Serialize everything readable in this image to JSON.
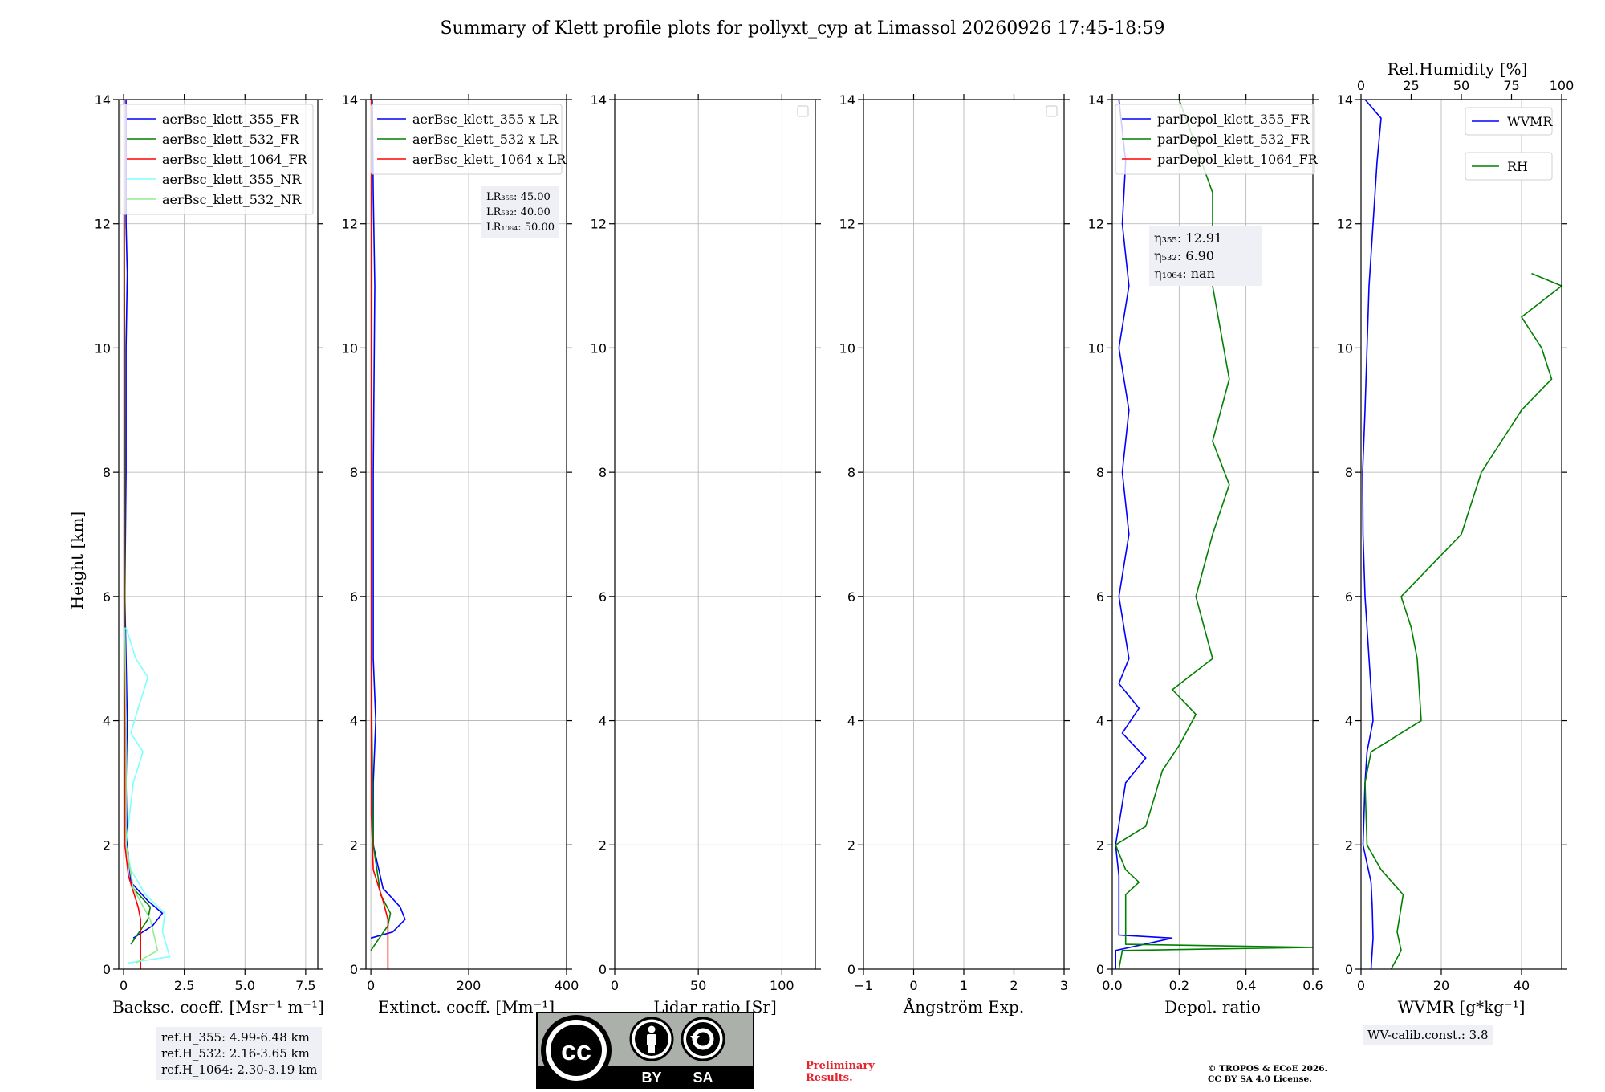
{
  "title": "Summary of Klett profile plots for pollyxt_cyp at Limassol 20260926 17:45-18:59",
  "ylabel": "Height [km]",
  "rh_axis_label": "Rel.Humidity [%]",
  "ref_heights": [
    "ref.H_355: 4.99-6.48 km",
    "ref.H_532: 2.16-3.65 km",
    "ref.H_1064: 2.30-3.19 km"
  ],
  "wv_calib": "WV-calib.const.: 3.8",
  "preliminary": [
    "Preliminary",
    "Results."
  ],
  "copyright": [
    "© TROPOS & ECoE 2026.",
    "CC BY SA 4.0 License."
  ],
  "cc_badge": {
    "text": "cc",
    "by": "BY",
    "sa": "SA"
  },
  "colors": {
    "blue": "#0000ff",
    "green": "#008000",
    "red": "#ff0000",
    "cyan": "#7fffff",
    "lightgreen": "#90ee90"
  },
  "chart_data": [
    {
      "type": "line",
      "id": "backscatter",
      "xlabel": "Backsc. coeff. [Msr⁻¹ m⁻¹]",
      "xlim": [
        -0.2,
        8.0
      ],
      "xticks": [
        "0",
        "2.5",
        "5.0",
        "7.5"
      ],
      "xtick_values": [
        0,
        2.5,
        5.0,
        7.5
      ],
      "ylim": [
        0,
        14
      ],
      "yticks": [
        "0",
        "2",
        "4",
        "6",
        "8",
        "10",
        "12",
        "14"
      ],
      "grid": true,
      "legend_position": "top-right",
      "series": [
        {
          "name": "aerBsc_klett_355_FR",
          "color": "blue",
          "points": [
            [
              0.4,
              0.5
            ],
            [
              1.2,
              0.7
            ],
            [
              1.6,
              0.9
            ],
            [
              1.0,
              1.1
            ],
            [
              0.3,
              1.4
            ],
            [
              0.15,
              2.0
            ],
            [
              0.1,
              3.0
            ],
            [
              0.15,
              4.0
            ],
            [
              0.1,
              5.0
            ],
            [
              0.05,
              6.0
            ],
            [
              0.1,
              8.0
            ],
            [
              0.1,
              10.0
            ],
            [
              0.15,
              11.2
            ],
            [
              0.1,
              12.0
            ],
            [
              0.1,
              14.0
            ]
          ]
        },
        {
          "name": "aerBsc_klett_532_FR",
          "color": "green",
          "points": [
            [
              0.3,
              0.4
            ],
            [
              1.0,
              0.8
            ],
            [
              1.1,
              1.0
            ],
            [
              0.4,
              1.3
            ],
            [
              0.1,
              2.0
            ],
            [
              0.05,
              4.0
            ],
            [
              0.05,
              8.0
            ],
            [
              0.02,
              14.0
            ]
          ]
        },
        {
          "name": "aerBsc_klett_1064_FR",
          "color": "red",
          "points": [
            [
              0.7,
              0.0
            ],
            [
              0.7,
              0.8
            ],
            [
              0.6,
              1.0
            ],
            [
              0.2,
              1.5
            ],
            [
              0.05,
              2.0
            ],
            [
              0.02,
              6.0
            ],
            [
              0.02,
              14.0
            ]
          ]
        },
        {
          "name": "aerBsc_klett_355_NR",
          "color": "cyan",
          "points": [
            [
              0.2,
              0.1
            ],
            [
              1.9,
              0.2
            ],
            [
              1.6,
              0.6
            ],
            [
              1.7,
              0.9
            ],
            [
              0.9,
              1.2
            ],
            [
              0.3,
              1.6
            ],
            [
              0.1,
              2.0
            ],
            [
              0.4,
              3.0
            ],
            [
              0.8,
              3.5
            ],
            [
              0.3,
              3.8
            ],
            [
              0.6,
              4.2
            ],
            [
              1.0,
              4.7
            ],
            [
              0.5,
              5.0
            ],
            [
              0.1,
              5.5
            ]
          ]
        },
        {
          "name": "aerBsc_klett_532_NR",
          "color": "lightgreen",
          "points": [
            [
              0.5,
              0.1
            ],
            [
              1.4,
              0.3
            ],
            [
              1.1,
              0.8
            ],
            [
              0.4,
              1.3
            ],
            [
              0.1,
              2.0
            ],
            [
              0.1,
              4.0
            ],
            [
              0.05,
              5.5
            ]
          ]
        }
      ]
    },
    {
      "type": "line",
      "id": "extinction",
      "xlabel": "Extinct. coeff. [Mm⁻¹]",
      "xlim": [
        -10,
        400
      ],
      "xticks": [
        "0",
        "200",
        "400"
      ],
      "xtick_values": [
        0,
        200,
        400
      ],
      "ylim": [
        0,
        14
      ],
      "yticks": [
        "0",
        "2",
        "4",
        "6",
        "8",
        "10",
        "12",
        "14"
      ],
      "grid": true,
      "legend_position": "top-right",
      "annotation": {
        "lines": [
          "LR₃₅₅: 45.00",
          "LR₅₃₂: 40.00",
          "LR₁₀₆₄: 50.00"
        ]
      },
      "series": [
        {
          "name": "aerBsc_klett_355 x LR",
          "color": "blue",
          "points": [
            [
              0,
              0.5
            ],
            [
              45,
              0.6
            ],
            [
              70,
              0.8
            ],
            [
              60,
              1.0
            ],
            [
              25,
              1.3
            ],
            [
              5,
              2.0
            ],
            [
              5,
              3.0
            ],
            [
              10,
              4.0
            ],
            [
              5,
              5.0
            ],
            [
              5,
              8.0
            ],
            [
              8,
              11.0
            ],
            [
              5,
              12.5
            ],
            [
              3,
              14.0
            ]
          ]
        },
        {
          "name": "aerBsc_klett_532 x LR",
          "color": "green",
          "points": [
            [
              0,
              0.3
            ],
            [
              35,
              0.7
            ],
            [
              40,
              0.9
            ],
            [
              20,
              1.2
            ],
            [
              5,
              2.0
            ],
            [
              2,
              4.0
            ],
            [
              2,
              14.0
            ]
          ]
        },
        {
          "name": "aerBsc_klett_1064 x LR",
          "color": "red",
          "points": [
            [
              35,
              0.0
            ],
            [
              35,
              0.8
            ],
            [
              25,
              1.1
            ],
            [
              5,
              1.6
            ],
            [
              1,
              2.5
            ],
            [
              1,
              14.0
            ]
          ]
        }
      ]
    },
    {
      "type": "line",
      "id": "lidar_ratio",
      "xlabel": "Lidar ratio [Sr]",
      "xlim": [
        0,
        120
      ],
      "xticks": [
        "0",
        "50",
        "100"
      ],
      "xtick_values": [
        0,
        50,
        100
      ],
      "ylim": [
        0,
        14
      ],
      "yticks": [
        "0",
        "2",
        "4",
        "6",
        "8",
        "10",
        "12",
        "14"
      ],
      "grid": true,
      "legend_position": "top-right",
      "series": []
    },
    {
      "type": "line",
      "id": "angstrom",
      "xlabel": "Ångström Exp.",
      "xlim": [
        -1,
        3
      ],
      "xticks": [
        "−1",
        "0",
        "1",
        "2",
        "3"
      ],
      "xtick_values": [
        -1,
        0,
        1,
        2,
        3
      ],
      "ylim": [
        0,
        14
      ],
      "yticks": [
        "0",
        "2",
        "4",
        "6",
        "8",
        "10",
        "12",
        "14"
      ],
      "grid": true,
      "legend_position": "top-right",
      "series": []
    },
    {
      "type": "line",
      "id": "depol",
      "xlabel": "Depol. ratio",
      "xlim": [
        0,
        0.6
      ],
      "xticks": [
        "0.0",
        "0.2",
        "0.4",
        "0.6"
      ],
      "xtick_values": [
        0,
        0.2,
        0.4,
        0.6
      ],
      "ylim": [
        0,
        14
      ],
      "yticks": [
        "0",
        "2",
        "4",
        "6",
        "8",
        "10",
        "12",
        "14"
      ],
      "grid": true,
      "legend_position": "top-left",
      "annotation": {
        "lines": [
          "η₃₅₅: 12.91",
          "η₅₃₂: 6.90",
          "η₁₀₆₄: nan"
        ]
      },
      "series": [
        {
          "name": "parDepol_klett_355_FR",
          "color": "blue",
          "points": [
            [
              0.01,
              0.0
            ],
            [
              0.01,
              0.3
            ],
            [
              0.18,
              0.5
            ],
            [
              0.02,
              0.55
            ],
            [
              0.02,
              1.5
            ],
            [
              0.01,
              2.0
            ],
            [
              0.04,
              3.0
            ],
            [
              0.1,
              3.4
            ],
            [
              0.03,
              3.8
            ],
            [
              0.08,
              4.2
            ],
            [
              0.02,
              4.6
            ],
            [
              0.05,
              5.0
            ],
            [
              0.02,
              6.0
            ],
            [
              0.05,
              7.0
            ],
            [
              0.03,
              8.0
            ],
            [
              0.05,
              9.0
            ],
            [
              0.02,
              10.0
            ],
            [
              0.05,
              11.0
            ],
            [
              0.03,
              12.0
            ],
            [
              0.04,
              13.0
            ],
            [
              0.02,
              14.0
            ]
          ]
        },
        {
          "name": "parDepol_klett_532_FR",
          "color": "green",
          "points": [
            [
              0.02,
              0.0
            ],
            [
              0.03,
              0.3
            ],
            [
              0.6,
              0.35
            ],
            [
              0.04,
              0.4
            ],
            [
              0.04,
              1.2
            ],
            [
              0.08,
              1.4
            ],
            [
              0.04,
              1.6
            ],
            [
              0.01,
              2.0
            ],
            [
              0.1,
              2.3
            ],
            [
              0.15,
              3.2
            ],
            [
              0.2,
              3.6
            ],
            [
              0.25,
              4.1
            ],
            [
              0.18,
              4.5
            ],
            [
              0.3,
              5.0
            ],
            [
              0.25,
              6.0
            ],
            [
              0.3,
              7.0
            ],
            [
              0.35,
              7.8
            ],
            [
              0.3,
              8.5
            ],
            [
              0.35,
              9.5
            ],
            [
              0.3,
              11.0
            ],
            [
              0.3,
              12.5
            ],
            [
              0.2,
              14.0
            ]
          ]
        },
        {
          "name": "parDepol_klett_1064_FR",
          "color": "red",
          "points": []
        }
      ]
    },
    {
      "type": "line",
      "id": "wvmr",
      "xlabel": "WVMR [g*kg⁻¹]",
      "xlim": [
        0,
        50
      ],
      "xticks": [
        "0",
        "20",
        "40"
      ],
      "xtick_values": [
        0,
        20,
        40
      ],
      "secondary_xlabel": "Rel.Humidity [%]",
      "secondary_xlim": [
        0,
        100
      ],
      "secondary_xticks": [
        "0",
        "25",
        "50",
        "75",
        "100"
      ],
      "secondary_xtick_values": [
        0,
        25,
        50,
        75,
        100
      ],
      "ylim": [
        0,
        14
      ],
      "yticks": [
        "0",
        "2",
        "4",
        "6",
        "8",
        "10",
        "12",
        "14"
      ],
      "grid": true,
      "legend_position": "top-right",
      "series": [
        {
          "name": "WVMR",
          "color": "blue",
          "axis": "bottom",
          "points": [
            [
              2.5,
              0.0
            ],
            [
              3.0,
              0.5
            ],
            [
              2.8,
              1.0
            ],
            [
              2.5,
              1.4
            ],
            [
              0.5,
              2.0
            ],
            [
              1.0,
              3.0
            ],
            [
              1.5,
              3.5
            ],
            [
              3.0,
              4.0
            ],
            [
              2.0,
              5.0
            ],
            [
              1.0,
              6.0
            ],
            [
              0.5,
              7.0
            ],
            [
              0.4,
              8.0
            ],
            [
              1.0,
              9.0
            ],
            [
              1.5,
              10.0
            ],
            [
              2.0,
              11.0
            ],
            [
              3.0,
              12.0
            ],
            [
              4.0,
              13.0
            ],
            [
              5.0,
              13.7
            ],
            [
              1.0,
              14.0
            ]
          ]
        },
        {
          "name": "RH",
          "color": "green",
          "axis": "top",
          "points": [
            [
              15,
              0.0
            ],
            [
              20,
              0.3
            ],
            [
              18,
              0.6
            ],
            [
              21,
              1.2
            ],
            [
              10,
              1.6
            ],
            [
              3,
              2.0
            ],
            [
              2,
              3.0
            ],
            [
              5,
              3.5
            ],
            [
              30,
              4.0
            ],
            [
              28,
              5.0
            ],
            [
              25,
              5.5
            ],
            [
              20,
              6.0
            ],
            [
              35,
              6.5
            ],
            [
              50,
              7.0
            ],
            [
              60,
              8.0
            ],
            [
              70,
              8.5
            ],
            [
              80,
              9.0
            ],
            [
              95,
              9.5
            ],
            [
              90,
              10.0
            ],
            [
              80,
              10.5
            ],
            [
              100,
              11.0
            ],
            [
              85,
              11.2
            ]
          ]
        }
      ]
    }
  ]
}
